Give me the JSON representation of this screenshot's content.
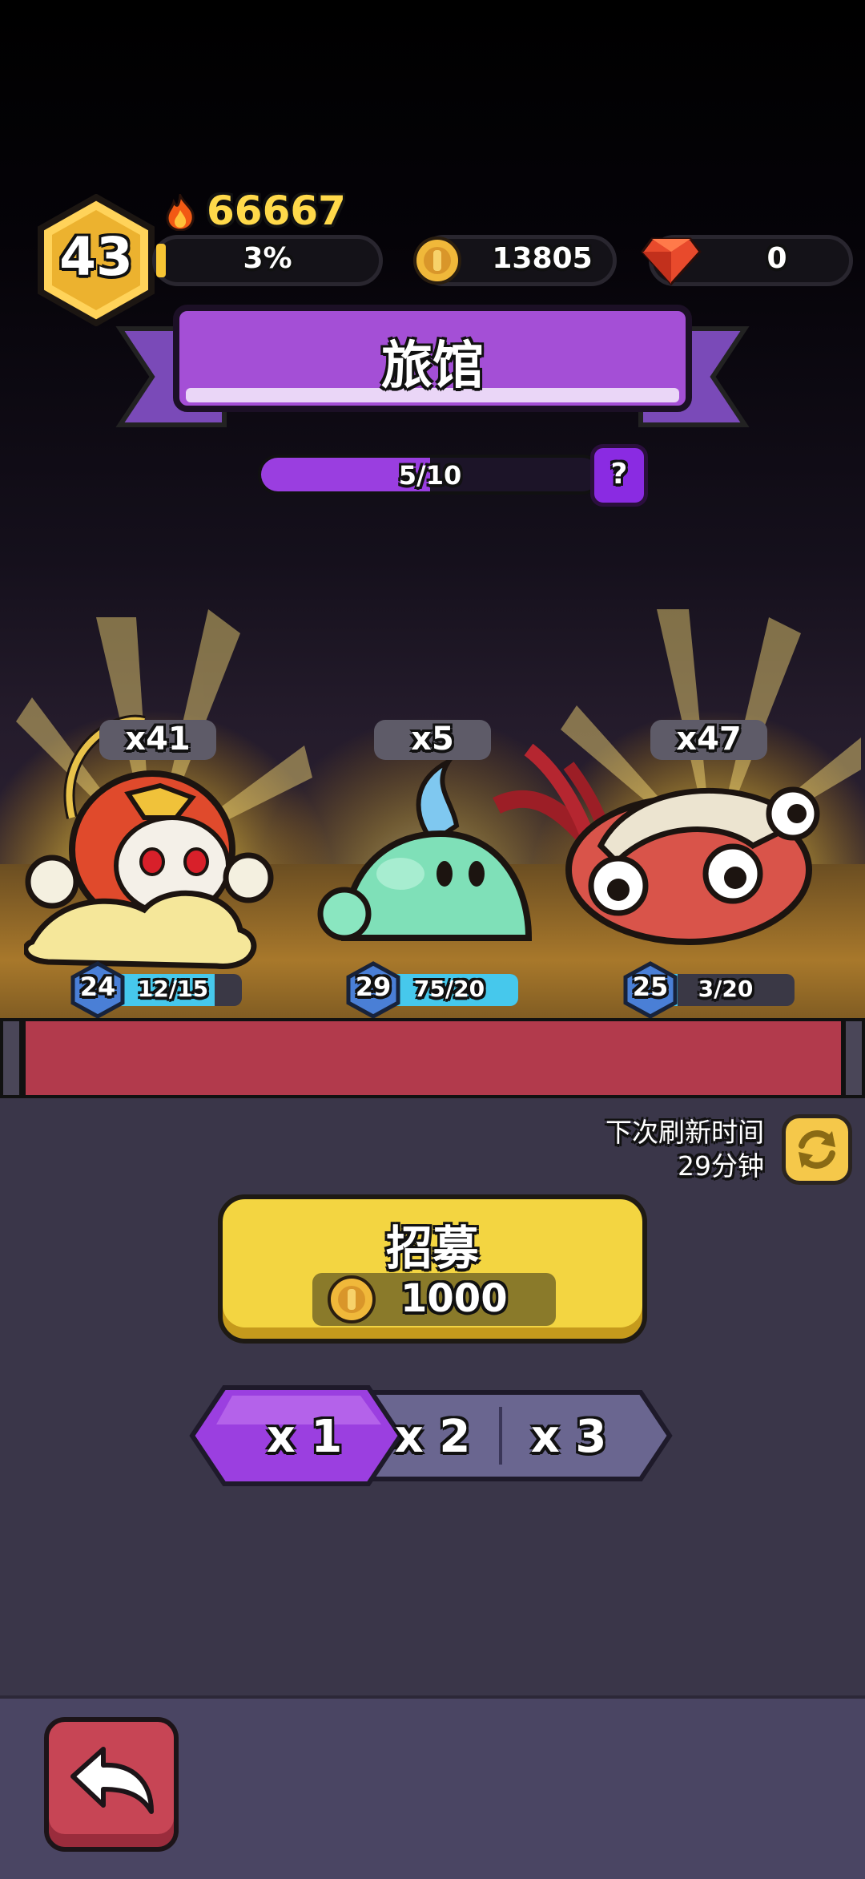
{
  "hud": {
    "level": "43",
    "power": "66667",
    "xp_percent_label": "3%",
    "xp_fraction": 0.03,
    "coins": "13805",
    "gems": "0"
  },
  "banner": {
    "title": "旅馆"
  },
  "progress": {
    "label": "5/10",
    "fraction": 0.5,
    "help_label": "?"
  },
  "creatures": [
    {
      "count": "x41",
      "level": "24",
      "stat": "12/15",
      "fill": 0.8,
      "icon": "monkey-king-on-cloud"
    },
    {
      "count": "x5",
      "level": "29",
      "stat": "75/20",
      "fill": 1.0,
      "icon": "green-slime"
    },
    {
      "count": "x47",
      "level": "25",
      "stat": "3/20",
      "fill": 0.15,
      "icon": "squid-creature"
    }
  ],
  "refresh": {
    "line1": "下次刷新时间",
    "line2": "29分钟"
  },
  "recruit": {
    "title": "招募",
    "cost": "1000"
  },
  "multipliers": [
    "x 1",
    "x 2",
    "x 3"
  ],
  "multiplier_selected": 0,
  "colors": {
    "accent_purple": "#9b3fe0",
    "gold": "#f3d541",
    "stat_blue": "#46c8ec",
    "back_red": "#c74555"
  },
  "footer": {
    "back_icon": "back-arrow-icon"
  }
}
